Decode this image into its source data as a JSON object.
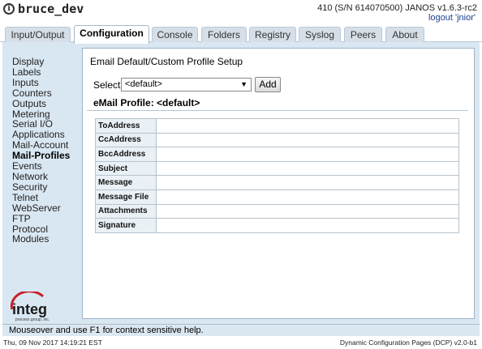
{
  "header": {
    "hostname": "bruce_dev",
    "serial_info": "410 (S/N 614070500) JANOS v1.6.3-rc2",
    "logout_label": "logout 'jnior'"
  },
  "tabs": [
    "Input/Output",
    "Configuration",
    "Console",
    "Folders",
    "Registry",
    "Syslog",
    "Peers",
    "About"
  ],
  "active_tab": "Configuration",
  "sidebar": {
    "items": [
      "Display",
      "Labels",
      "Inputs",
      "Counters",
      "Outputs",
      "Metering",
      "Serial I/O",
      "Applications",
      "Mail-Account",
      "Mail-Profiles",
      "Events",
      "Network",
      "Security",
      "Telnet",
      "WebServer",
      "FTP",
      "Protocol",
      "Modules"
    ],
    "active": "Mail-Profiles"
  },
  "logo": {
    "brand": "integ",
    "tagline": "process group, inc."
  },
  "content": {
    "title": "Email Default/Custom Profile Setup",
    "select_label": "Select",
    "select_value": "<default>",
    "add_label": "Add",
    "profile_heading": "eMail Profile: <default>",
    "fields": [
      {
        "label": "ToAddress",
        "value": ""
      },
      {
        "label": "CcAddress",
        "value": ""
      },
      {
        "label": "BccAddress",
        "value": ""
      },
      {
        "label": "Subject",
        "value": ""
      },
      {
        "label": "Message",
        "value": ""
      },
      {
        "label": "Message File",
        "value": ""
      },
      {
        "label": "Attachments",
        "value": ""
      },
      {
        "label": "Signature",
        "value": ""
      }
    ]
  },
  "status": {
    "help_text": "Mouseover and use F1 for context sensitive help.",
    "timestamp": "Thu, 09 Nov 2017 14:19:21 EST",
    "version": "Dynamic Configuration Pages (DCP) v2.0-b1"
  },
  "colors": {
    "panel_bg": "#d9e7f2",
    "tab_bg": "#d6dfe8",
    "link": "#1b3f8f",
    "logo_red": "#c8202c"
  }
}
